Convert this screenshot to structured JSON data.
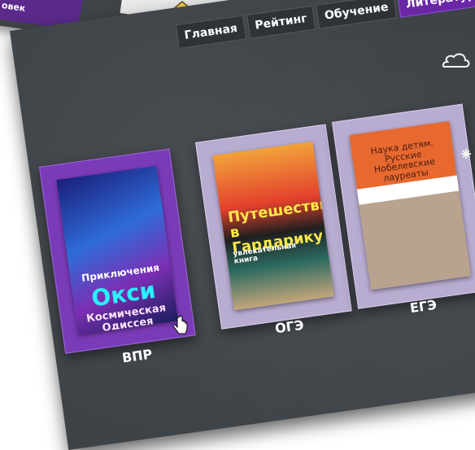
{
  "back": {
    "label": "овек"
  },
  "nav": {
    "items": [
      "Главная",
      "Рейтинг",
      "Обучение",
      "Литература"
    ],
    "active": "Литература"
  },
  "cards": [
    {
      "cover_title_1": "Приключения",
      "cover_title_2": "Окси",
      "cover_title_3": "Космическая Одиссея",
      "grade": "ВПР"
    },
    {
      "cover_title_1": "Путешествие в Гардарику",
      "cover_subtitle": "увлекательная книга",
      "grade": "ОГЭ"
    },
    {
      "cover_title_1": "Наука детям. Русские Нобелевские лауреаты",
      "grade": "ЕГЭ"
    }
  ],
  "icons": {
    "home": "house-icon",
    "cursor": "hand-cursor-icon",
    "chalk_cloud": "cloud-icon",
    "chalk_star": "asterisk-icon"
  },
  "colors": {
    "board": "#3e4348",
    "accent": "#6a27a5",
    "card": "#b9acd1",
    "card_highlight": "#7a3bb8"
  }
}
